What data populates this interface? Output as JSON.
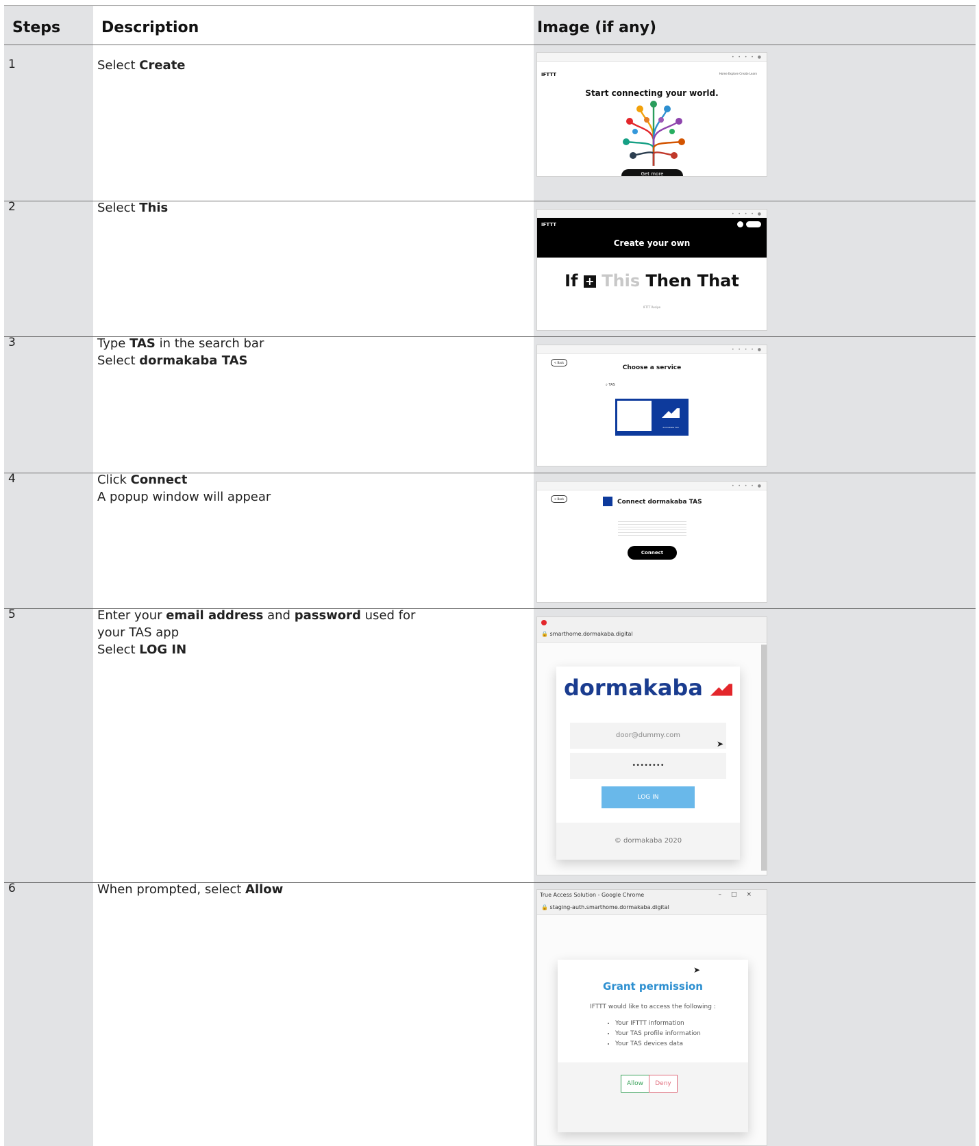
{
  "headers": {
    "steps": "Steps",
    "description": "Description",
    "image": "Image (if any)"
  },
  "rows": [
    {
      "step": "1",
      "lines": [
        [
          "Select ",
          "Create"
        ]
      ]
    },
    {
      "step": "2",
      "lines": [
        [
          "Select ",
          "This"
        ]
      ]
    },
    {
      "step": "3",
      "lines": [
        [
          "Type ",
          "TAS",
          " in the search bar"
        ],
        [
          "Select ",
          "dormakaba TAS"
        ]
      ]
    },
    {
      "step": "4",
      "lines": [
        [
          "Click ",
          "Connect"
        ],
        [
          "A popup window will appear"
        ]
      ]
    },
    {
      "step": "5",
      "lines": [
        [
          "Enter your ",
          "email address",
          " and ",
          "password",
          " used for"
        ],
        [
          "your TAS app"
        ],
        [
          "Select ",
          "LOG IN"
        ]
      ]
    },
    {
      "step": "6",
      "lines": [
        [
          "When prompted, select ",
          "Allow"
        ]
      ]
    }
  ],
  "shots": {
    "s1": {
      "logo": "IFTTT",
      "nav": "Home  Explore  Create  Learn",
      "headline": "Start connecting your world.",
      "cta": "Get more"
    },
    "s2": {
      "logo": "IFTTT",
      "banner": "Create your own",
      "if": "If",
      "this": "This",
      "then_that": "Then That",
      "footer": "IFTTT Recipe"
    },
    "s3": {
      "back": "< Back",
      "title": "Choose a service",
      "search": "TAS",
      "tile": "dormakaba TAS"
    },
    "s4": {
      "back": "< Back",
      "title": "Connect dormakaba TAS",
      "button": "Connect"
    },
    "s5": {
      "url": "smarthome.dormakaba.digital",
      "brand": "dormakaba",
      "email": "door@dummy.com",
      "password": "••••••••",
      "login": "LOG IN",
      "footer": "© dormakaba 2020"
    },
    "s6": {
      "window_title": "True Access Solution - Google Chrome",
      "url": "staging-auth.smarthome.dormakaba.digital",
      "title": "Grant permission",
      "intro": "IFTTT would like to access the following :",
      "items": [
        "Your IFTTT information",
        "Your TAS profile information",
        "Your TAS devices data"
      ],
      "allow": "Allow",
      "deny": "Deny"
    }
  },
  "colors": {
    "dormakaba_red": "#e3262b",
    "dormakaba_blue": "#1a3c8f",
    "tas_blue": "#0d3a9c",
    "login_blue": "#69b8ea",
    "grant_blue": "#2d8fd0",
    "allow_green": "#3aa35b",
    "deny_red": "#e06a7a"
  }
}
